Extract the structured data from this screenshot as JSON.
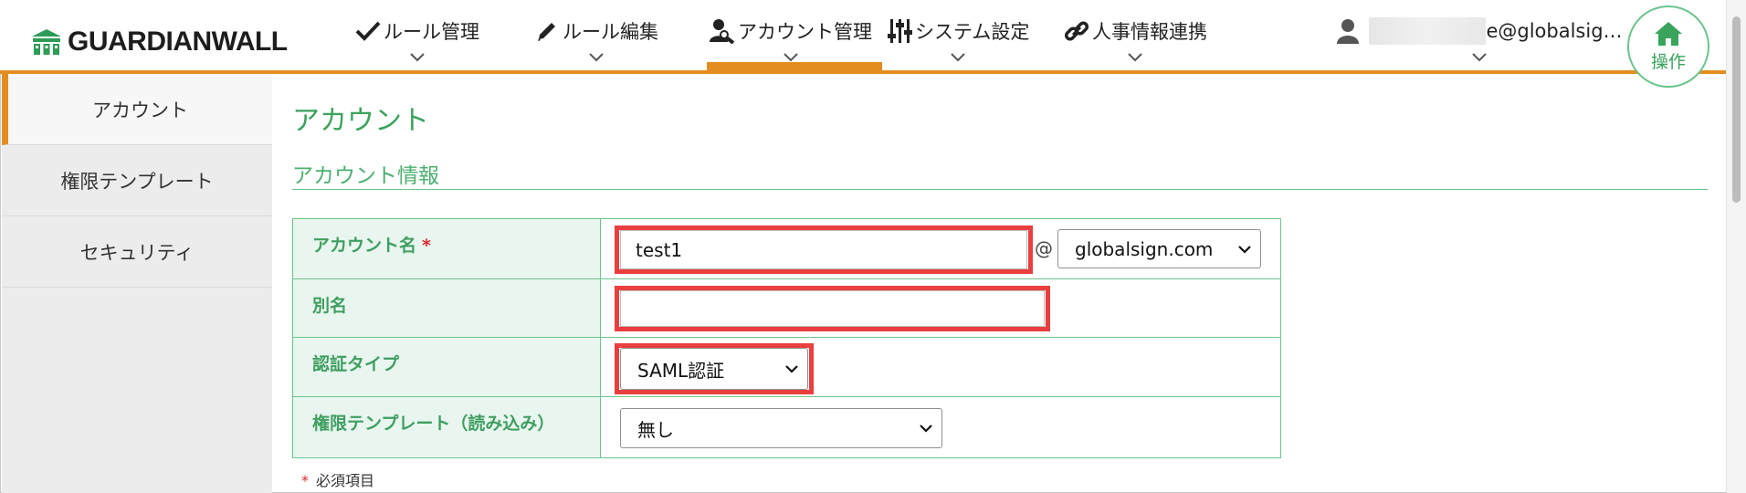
{
  "brand": {
    "name": "GUARDIANWALL"
  },
  "nav": {
    "items": [
      {
        "label": "ルール管理",
        "icon": "checkmark-icon"
      },
      {
        "label": "ルール編集",
        "icon": "pencil-icon"
      },
      {
        "label": "アカウント管理",
        "icon": "user-wrench-icon",
        "active": true
      },
      {
        "label": "システム設定",
        "icon": "sliders-icon"
      },
      {
        "label": "人事情報連携",
        "icon": "link-icon"
      }
    ],
    "user_email": "e@globalsig…",
    "home_label": "操作"
  },
  "sidebar": {
    "items": [
      {
        "label": "アカウント",
        "active": true
      },
      {
        "label": "権限テンプレート"
      },
      {
        "label": "セキュリティ"
      }
    ]
  },
  "main": {
    "page_title": "アカウント",
    "section_title": "アカウント情報",
    "form": {
      "account_name": {
        "label": "アカウント名",
        "required_mark": "*",
        "value": "test1",
        "at": "@",
        "domain": "globalsign.com"
      },
      "alias": {
        "label": "別名",
        "value": ""
      },
      "auth_type": {
        "label": "認証タイプ",
        "value": "SAML認証"
      },
      "template": {
        "label": "権限テンプレート（読み込み）",
        "value": "無し"
      }
    },
    "required_note": {
      "star": "*",
      "text": "必須項目"
    }
  },
  "colors": {
    "accent_orange": "#e38d21",
    "green": "#3aa35c",
    "highlight_red": "#ea3f3f",
    "label_bg": "#e8f6ef"
  }
}
